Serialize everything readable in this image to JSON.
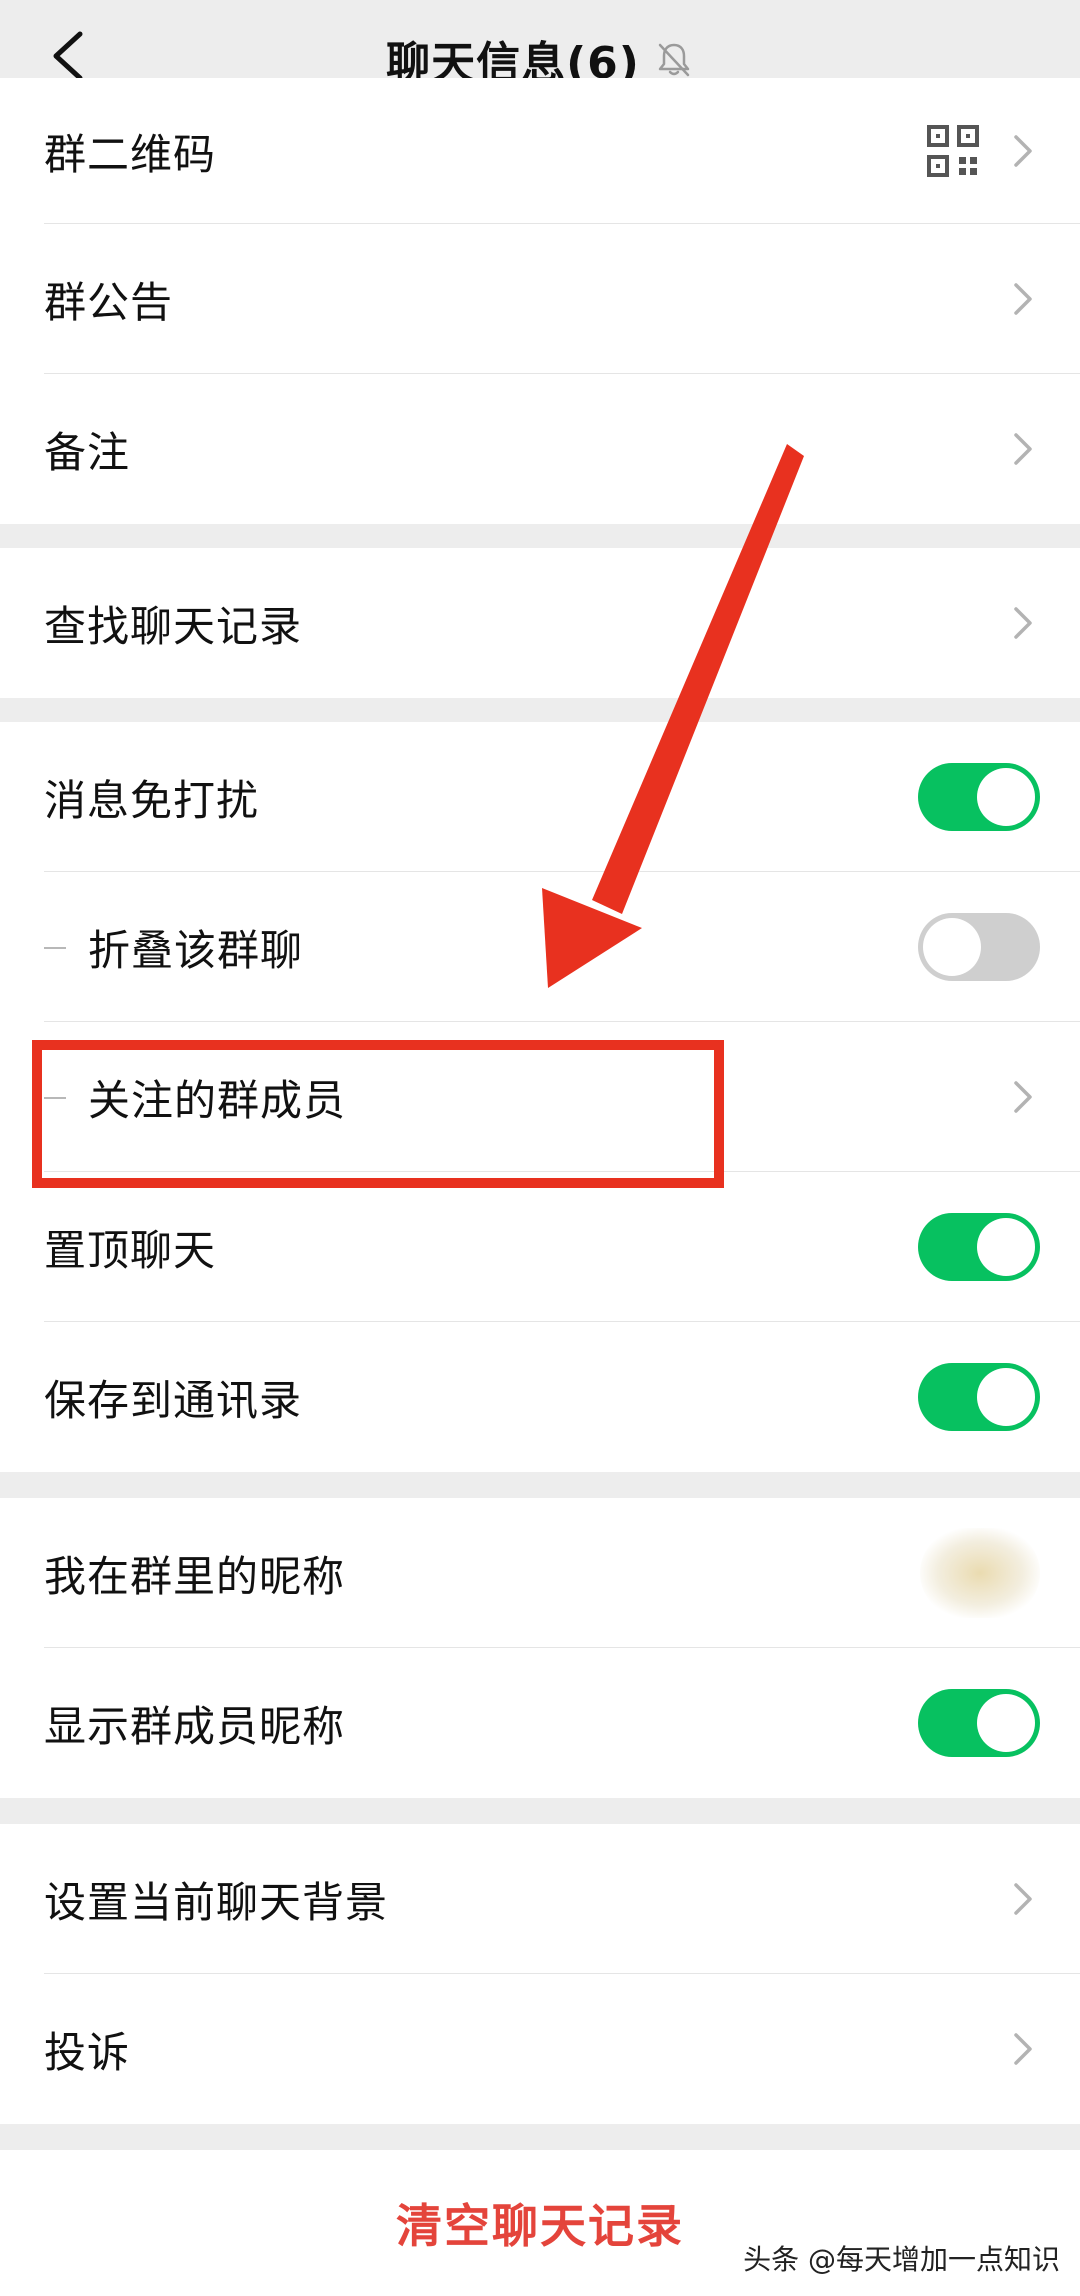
{
  "header": {
    "title": "聊天信息(6)",
    "back_icon": "chevron-left-icon",
    "mute_icon": "bell-off-icon"
  },
  "group1": {
    "items": [
      {
        "label": "群二维码",
        "accessory": "qr-code-icon"
      },
      {
        "label": "群公告"
      },
      {
        "label": "备注"
      }
    ]
  },
  "group2": {
    "items": [
      {
        "label": "查找聊天记录"
      }
    ]
  },
  "group3": {
    "items": [
      {
        "label": "消息免打扰",
        "toggle": "on"
      },
      {
        "label": "折叠该群聊",
        "toggle": "off"
      },
      {
        "label": "关注的群成员"
      },
      {
        "label": "置顶聊天",
        "toggle": "on"
      },
      {
        "label": "保存到通讯录",
        "toggle": "on"
      }
    ]
  },
  "group4": {
    "items": [
      {
        "label": "我在群里的昵称"
      },
      {
        "label": "显示群成员昵称",
        "toggle": "on"
      }
    ]
  },
  "group5": {
    "items": [
      {
        "label": "设置当前聊天背景"
      },
      {
        "label": "投诉"
      }
    ]
  },
  "footer": {
    "clear_label": "清空聊天记录",
    "watermark": "头条 @每天增加一点知识"
  },
  "colors": {
    "accent_green": "#07c160",
    "danger_red": "#e4443b",
    "annotation_red": "#e8311f",
    "background": "#ededed"
  }
}
